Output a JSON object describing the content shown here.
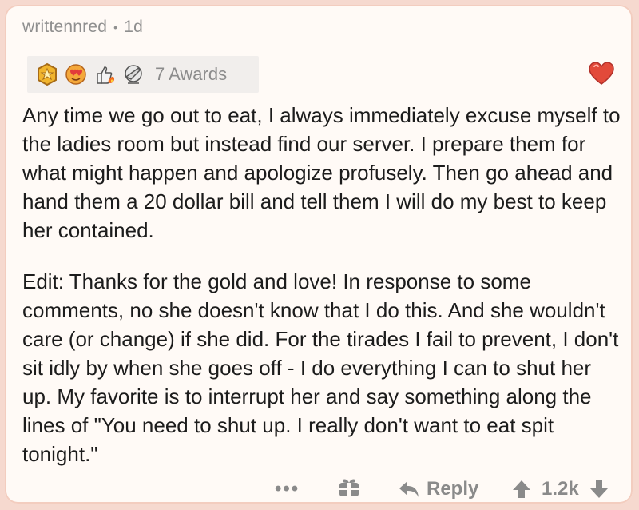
{
  "comment": {
    "author": "writtennred",
    "separator": "•",
    "age": "1d",
    "awards": {
      "icons": [
        "gold-medal-icon",
        "heart-eyes-icon",
        "thumbs-up-flame-icon",
        "facepalm-icon"
      ],
      "label": "7 Awards"
    },
    "body": [
      "Any time we go out to eat, I always immediately excuse myself to the ladies room but instead find our server. I prepare them for what might happen and apologize profusely. Then go ahead and hand them a 20 dollar bill and tell them I will do my best to keep her contained.",
      "Edit: Thanks for the gold and love! In response to some comments, no she doesn't know that I do this. And she wouldn't care (or change) if she did. For the tirades I fail to prevent, I don't sit idly by when she goes off  - I do everything I can to shut her up. My favorite is to interrupt her and say something along the lines of \"You need to shut up. I really don't want to eat spit tonight.\""
    ],
    "actions": {
      "more": "•••",
      "reply": "Reply",
      "score": "1.2k"
    },
    "colors": {
      "accent": "#e0583a",
      "muted": "#8a8a8a",
      "card": "#fffaf6",
      "border": "#f6d9cf"
    }
  }
}
